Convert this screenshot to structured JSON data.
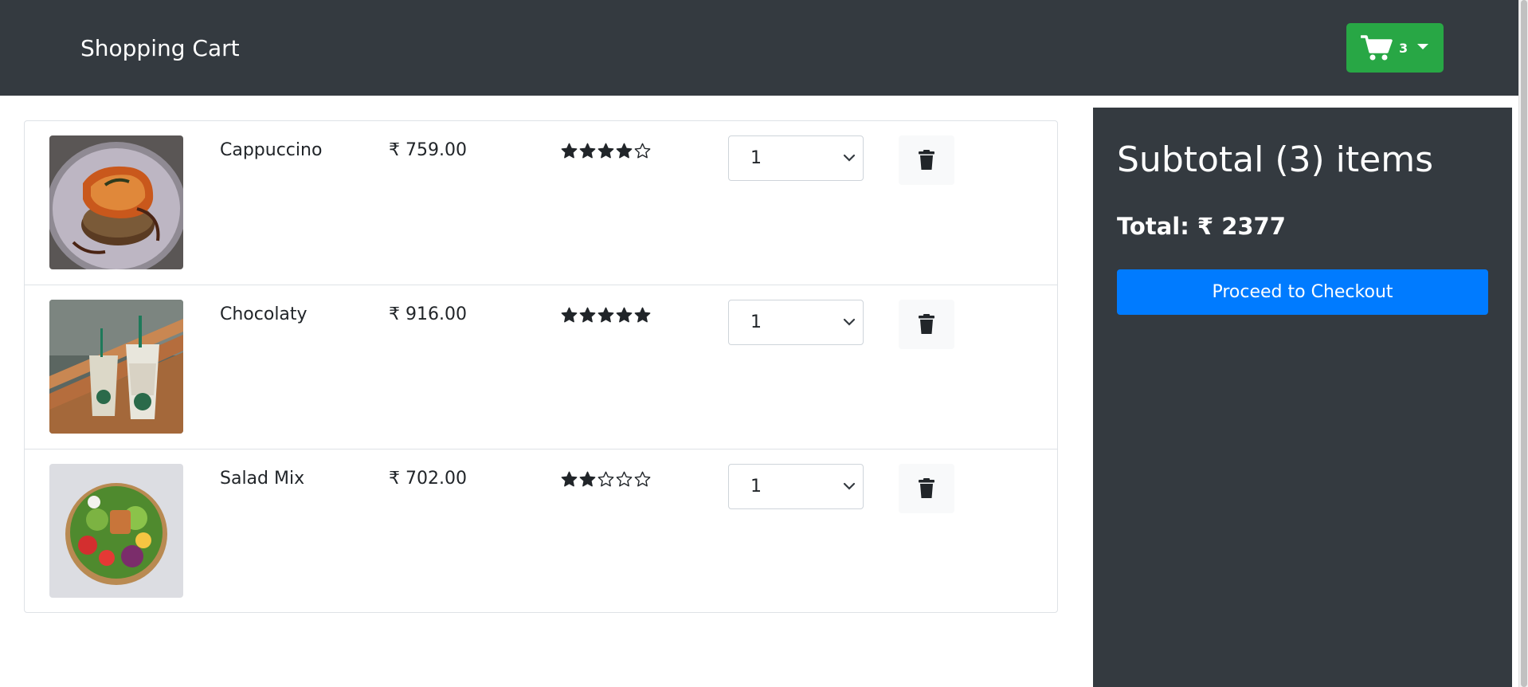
{
  "navbar": {
    "brand": "Shopping Cart",
    "cart_count": "3",
    "cart_icon": "shopping-cart-icon",
    "colors": {
      "bg": "#343a40",
      "cart_button": "#28a745"
    }
  },
  "cart": {
    "items": [
      {
        "name": "Cappuccino",
        "price": "₹ 759.00",
        "rating": 4,
        "max_rating": 5,
        "quantity": "1"
      },
      {
        "name": "Chocolaty",
        "price": "₹ 916.00",
        "rating": 5,
        "max_rating": 5,
        "quantity": "1"
      },
      {
        "name": "Salad Mix",
        "price": "₹ 702.00",
        "rating": 2,
        "max_rating": 5,
        "quantity": "1"
      }
    ]
  },
  "summary": {
    "title": "Subtotal (3) items",
    "total": "Total: ₹ 2377",
    "checkout_label": "Proceed to Checkout",
    "colors": {
      "bg": "#343a40",
      "checkout": "#007bff"
    }
  }
}
